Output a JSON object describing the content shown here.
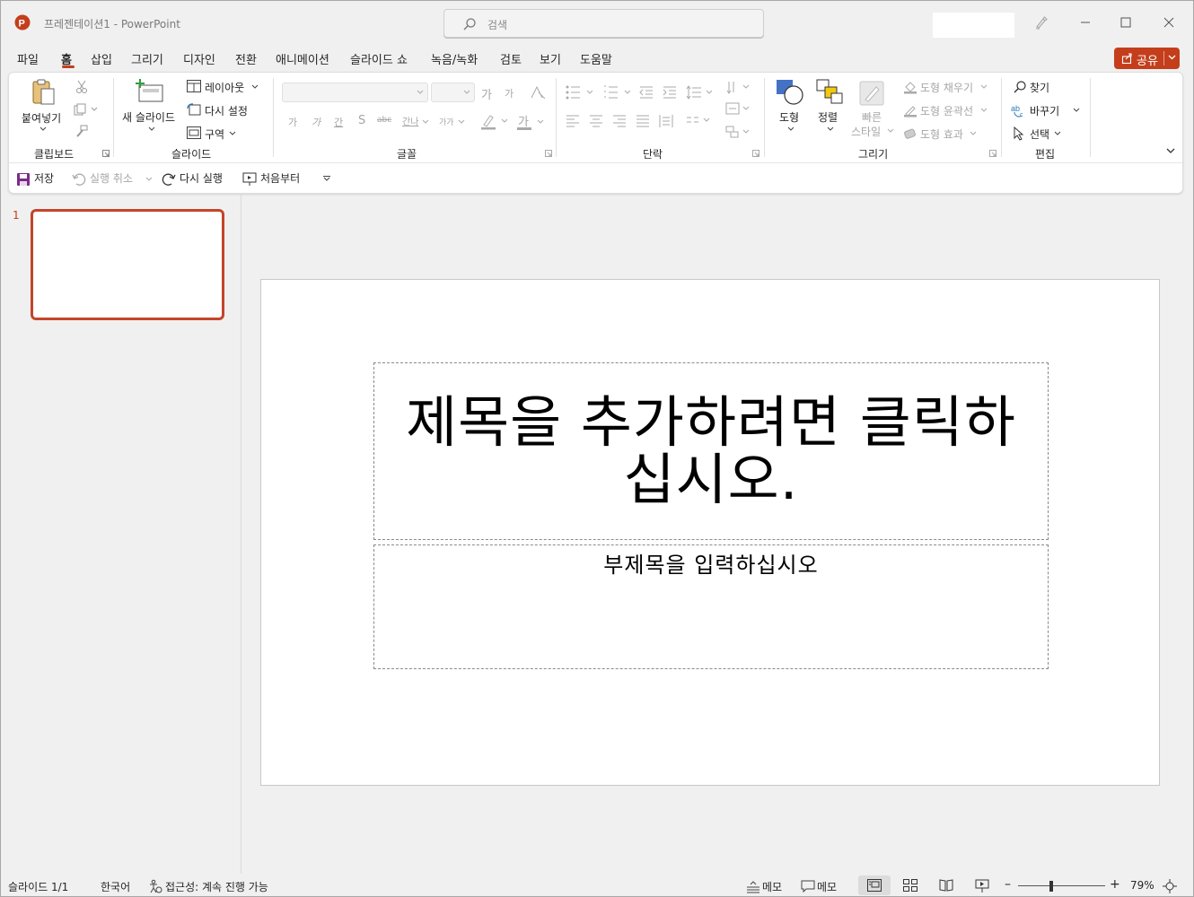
{
  "window": {
    "doc_title": "프레젠테이션1  -  PowerPoint",
    "search_placeholder": "검색"
  },
  "tabs": [
    {
      "label": "파일"
    },
    {
      "label": "홈",
      "active": true
    },
    {
      "label": "삽입"
    },
    {
      "label": "그리기"
    },
    {
      "label": "디자인"
    },
    {
      "label": "전환"
    },
    {
      "label": "애니메이션"
    },
    {
      "label": "슬라이드 쇼"
    },
    {
      "label": "녹음/녹화"
    },
    {
      "label": "검토"
    },
    {
      "label": "보기"
    },
    {
      "label": "도움말"
    }
  ],
  "share": {
    "label": "공유"
  },
  "ribbon": {
    "clipboard": {
      "group": "클립보드",
      "paste": "붙여넣기"
    },
    "slides": {
      "group": "슬라이드",
      "new_slide": "새 슬라이드",
      "layout": "레이아웃",
      "reset": "다시 설정",
      "section": "구역"
    },
    "font": {
      "group": "글꼴",
      "grow": "가",
      "shrink": "가",
      "bold": "가",
      "italic": "가",
      "underline": "간",
      "shadow": "S",
      "strike": "abc",
      "spacing": "간나",
      "case": "가가",
      "highlight": "",
      "font_color": "가"
    },
    "paragraph": {
      "group": "단락"
    },
    "drawing": {
      "group": "그리기",
      "shapes": "도형",
      "arrange": "정렬",
      "quick_styles_1": "빠른",
      "quick_styles_2": "스타일",
      "fill": "도형 채우기",
      "outline": "도형 윤곽선",
      "effects": "도형 효과"
    },
    "editing": {
      "group": "편집",
      "find": "찾기",
      "replace": "바꾸기",
      "select": "선택"
    }
  },
  "quick_access": {
    "save": "저장",
    "undo": "실행 취소",
    "redo": "다시 실행",
    "from_beginning": "처음부터"
  },
  "thumbnails": [
    {
      "number": "1"
    }
  ],
  "slide": {
    "title_placeholder": "제목을 추가하려면 클릭하십시오.",
    "subtitle_placeholder": "부제목을 입력하십시오"
  },
  "status": {
    "slide_count": "슬라이드 1/1",
    "language": "한국어",
    "accessibility": "접근성: 계속 진행 가능",
    "notes": "메모",
    "comments": "메모",
    "zoom": "79%",
    "zoom_level": 0.79
  },
  "colors": {
    "accent": "#c43e1c",
    "ribbon_bg": "#ffffff",
    "window_bg": "#f0f0f0",
    "shape_blue": "#4472c4",
    "shape_yellow": "#f2c811"
  }
}
